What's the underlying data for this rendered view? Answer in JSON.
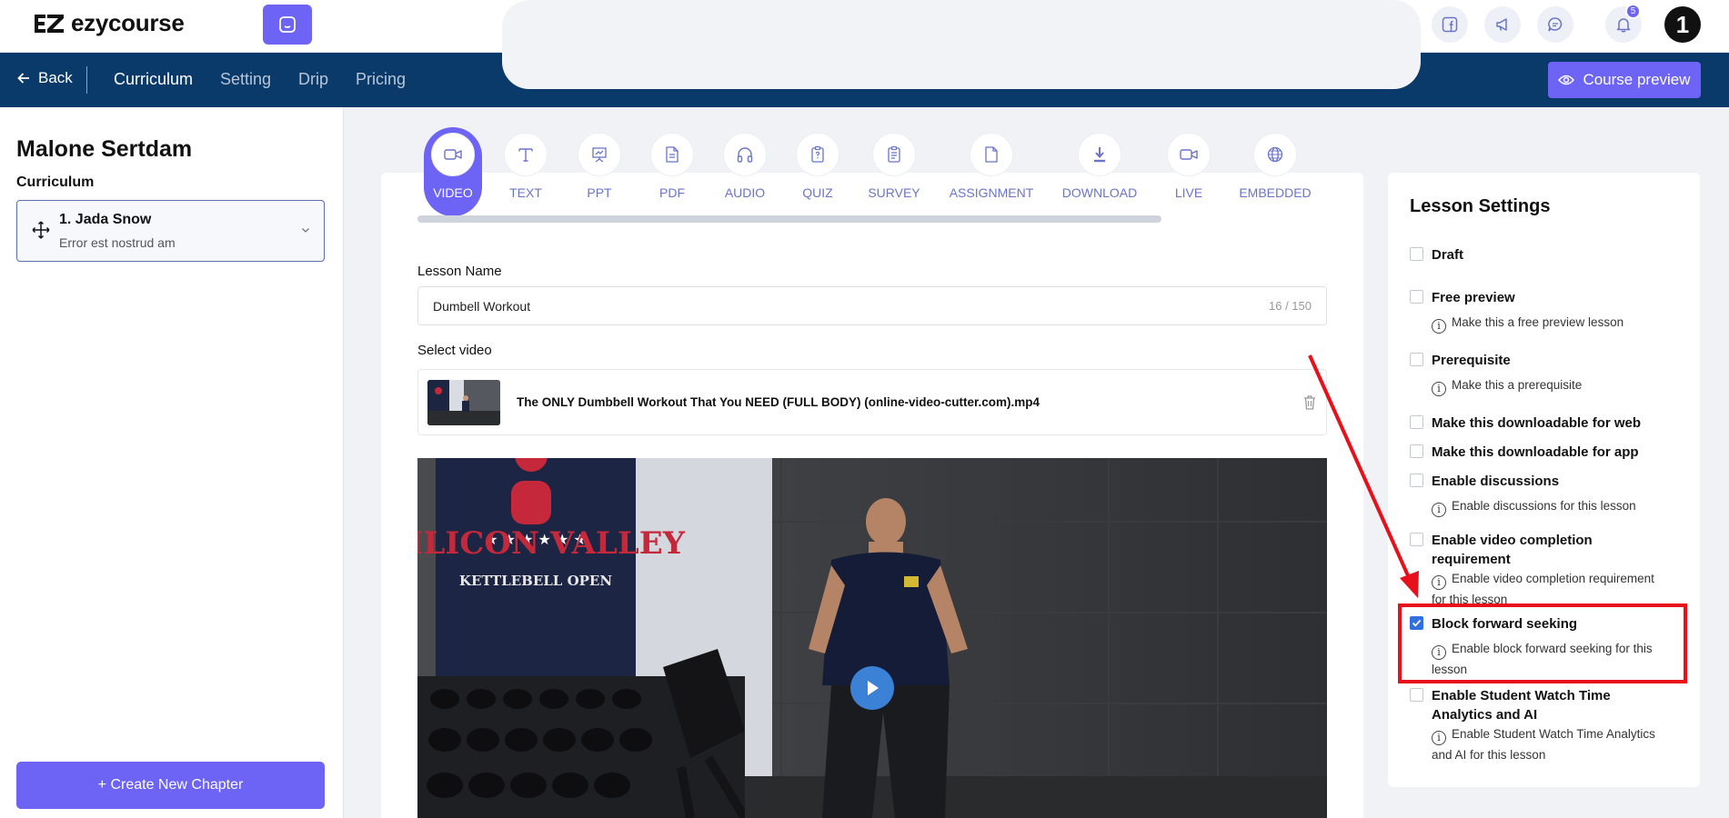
{
  "app": {
    "logo_text": "ezycourse",
    "notification_count": "5",
    "avatar_text": "1"
  },
  "nav": {
    "back_label": "Back",
    "tabs": [
      "Curriculum",
      "Setting",
      "Drip",
      "Pricing"
    ],
    "active_tab": "Curriculum",
    "preview_label": "Course preview"
  },
  "sidebar": {
    "course_title": "Malone Sertdam",
    "curriculum_label": "Curriculum",
    "chapter": {
      "title": "1. Jada Snow",
      "subtitle": "Error est nostrud am"
    },
    "create_chapter_label": "+ Create New Chapter"
  },
  "lesson_types": [
    "VIDEO",
    "TEXT",
    "PPT",
    "PDF",
    "AUDIO",
    "QUIZ",
    "SURVEY",
    "ASSIGNMENT",
    "DOWNLOAD",
    "LIVE",
    "EMBEDDED"
  ],
  "active_lesson_type": "VIDEO",
  "editor": {
    "lesson_name_label": "Lesson Name",
    "lesson_name_value": "Dumbell Workout",
    "lesson_name_count": "16 / 150",
    "select_video_label": "Select video",
    "video_file_name": "The ONLY Dumbbell Workout That You NEED (FULL BODY) (online-video-cutter.com).mp4",
    "banner_line1": "SILICON VALLEY",
    "banner_line2": "KETTLEBELL OPEN"
  },
  "settings": {
    "title": "Lesson Settings",
    "options": [
      {
        "label": "Draft",
        "help": "",
        "checked": false
      },
      {
        "label": "Free preview",
        "help": "Make this a free preview lesson",
        "checked": false
      },
      {
        "label": "Prerequisite",
        "help": "Make this a prerequisite",
        "checked": false
      },
      {
        "label": "Make this downloadable for web",
        "help": "",
        "checked": false
      },
      {
        "label": "Make this downloadable for app",
        "help": "",
        "checked": false
      },
      {
        "label": "Enable discussions",
        "help": "Enable discussions for this lesson",
        "checked": false
      },
      {
        "label": "Enable video completion requirement",
        "help": "Enable video completion requirement for this lesson",
        "checked": false
      },
      {
        "label": "Block forward seeking",
        "help": "Enable block forward seeking for this lesson",
        "checked": true
      },
      {
        "label": "Enable Student Watch Time Analytics and AI",
        "help": "Enable Student Watch Time Analytics and AI for this lesson",
        "checked": false
      }
    ]
  },
  "colors": {
    "accent": "#6d63f5",
    "nav_bg": "#0a3a6a",
    "annotation_red": "#e8101a",
    "checkbox_checked": "#2f6fe0"
  }
}
